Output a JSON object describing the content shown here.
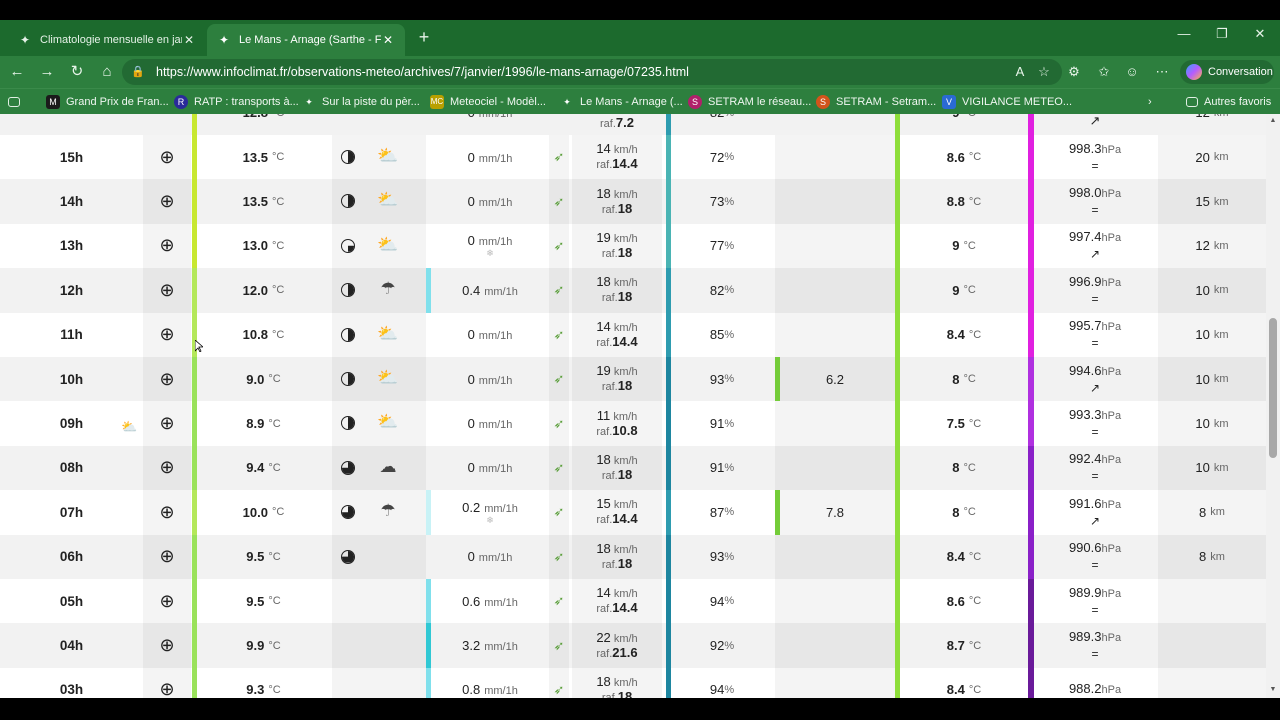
{
  "tabs": [
    {
      "label": "Climatologie mensuelle en janvier",
      "state": "inactive"
    },
    {
      "label": "Le Mans - Arnage (Sarthe - France",
      "state": "active"
    }
  ],
  "address": {
    "url": "https://www.infoclimat.fr/observations-meteo/archives/7/janvier/1996/le-mans-arnage/07235.html"
  },
  "conversation_label": "Conversation",
  "favorites": [
    {
      "label": "Grand Prix de Fran...",
      "icon": "M",
      "color": "#1b1b1b"
    },
    {
      "label": "RATP : transports à...",
      "icon": "R",
      "color": "#2a2a9a"
    },
    {
      "label": "Sur la piste du pèr...",
      "icon": "✦",
      "color": "#333"
    },
    {
      "label": "Meteociel - Modèl...",
      "icon": "MC",
      "color": "#b8a000"
    },
    {
      "label": "Le Mans - Arnage (...",
      "icon": "✦",
      "color": "#333"
    },
    {
      "label": "SETRAM le réseau...",
      "icon": "S",
      "color": "#b0206a"
    },
    {
      "label": "SETRAM - Setram...",
      "icon": "S",
      "color": "#d2541b"
    },
    {
      "label": "VIGILANCE METEO...",
      "icon": "V",
      "color": "#2a6ad2"
    },
    {
      "label": "Autres favoris",
      "icon": "▭",
      "color": "transparent"
    }
  ],
  "rows": [
    {
      "hour": "15h",
      "temp": "13.5",
      "moon": 0.5,
      "wx": "partly-cloudy",
      "prec": "0",
      "snow": "",
      "wind": "14",
      "gust": "14.4",
      "hum": "72",
      "extra": "",
      "dew": "8.6",
      "pres": "998.3",
      "trend": "=",
      "vis": "20"
    },
    {
      "hour": "14h",
      "temp": "13.5",
      "moon": 0.5,
      "wx": "partly-cloudy",
      "prec": "0",
      "snow": "",
      "wind": "18",
      "gust": "18",
      "hum": "73",
      "extra": "",
      "dew": "8.8",
      "pres": "998.0",
      "trend": "=",
      "vis": "15"
    },
    {
      "hour": "13h",
      "temp": "13.0",
      "moon": 0.4,
      "wx": "partly-cloudy",
      "prec": "0",
      "snow": "❄",
      "wind": "19",
      "gust": "18",
      "hum": "77",
      "extra": "",
      "dew": "9",
      "pres": "997.4",
      "trend": "↗",
      "vis": "12"
    },
    {
      "hour": "12h",
      "temp": "12.0",
      "moon": 0.5,
      "wx": "rain",
      "prec": "0.4",
      "snow": "",
      "wind": "18",
      "gust": "18",
      "hum": "82",
      "extra": "",
      "dew": "9",
      "pres": "996.9",
      "trend": "=",
      "vis": "10"
    },
    {
      "hour": "11h",
      "temp": "10.8",
      "moon": 0.5,
      "wx": "partly-cloudy",
      "prec": "0",
      "snow": "",
      "wind": "14",
      "gust": "14.4",
      "hum": "85",
      "extra": "",
      "dew": "8.4",
      "pres": "995.7",
      "trend": "=",
      "vis": "10"
    },
    {
      "hour": "10h",
      "temp": "9.0",
      "moon": 0.5,
      "wx": "partly-cloudy",
      "prec": "0",
      "snow": "",
      "wind": "19",
      "gust": "18",
      "hum": "93",
      "extra": "6.2",
      "dew": "8",
      "pres": "994.6",
      "trend": "↗",
      "vis": "10"
    },
    {
      "hour": "09h",
      "temp": "8.9",
      "moon": 0.5,
      "wx": "partly-cloudy",
      "prec": "0",
      "snow": "",
      "wind": "11",
      "gust": "10.8",
      "hum": "91",
      "extra": "",
      "dew": "7.5",
      "pres": "993.3",
      "trend": "=",
      "vis": "10"
    },
    {
      "hour": "08h",
      "temp": "9.4",
      "moon": 0.75,
      "wx": "cloud",
      "prec": "0",
      "snow": "",
      "wind": "18",
      "gust": "18",
      "hum": "91",
      "extra": "",
      "dew": "8",
      "pres": "992.4",
      "trend": "=",
      "vis": "10"
    },
    {
      "hour": "07h",
      "temp": "10.0",
      "moon": 0.75,
      "wx": "rain-snow",
      "prec": "0.2",
      "snow": "❄",
      "wind": "15",
      "gust": "14.4",
      "hum": "87",
      "extra": "7.8",
      "dew": "8",
      "pres": "991.6",
      "trend": "↗",
      "vis": "8"
    },
    {
      "hour": "06h",
      "temp": "9.5",
      "moon": 0.75,
      "wx": "",
      "prec": "0",
      "snow": "",
      "wind": "18",
      "gust": "18",
      "hum": "93",
      "extra": "",
      "dew": "8.4",
      "pres": "990.6",
      "trend": "=",
      "vis": "8"
    },
    {
      "hour": "05h",
      "temp": "9.5",
      "moon": 0,
      "wx": "",
      "prec": "0.6",
      "snow": "",
      "wind": "14",
      "gust": "14.4",
      "hum": "94",
      "extra": "",
      "dew": "8.6",
      "pres": "989.9",
      "trend": "=",
      "vis": ""
    },
    {
      "hour": "04h",
      "temp": "9.9",
      "moon": 0,
      "wx": "",
      "prec": "3.2",
      "snow": "",
      "wind": "22",
      "gust": "21.6",
      "hum": "92",
      "extra": "",
      "dew": "8.7",
      "pres": "989.3",
      "trend": "=",
      "vis": ""
    },
    {
      "hour": "03h",
      "temp": "9.3",
      "moon": 0,
      "wx": "",
      "prec": "0.8",
      "snow": "",
      "wind": "18",
      "gust": "18",
      "hum": "94",
      "extra": "",
      "dew": "8.4",
      "pres": "988.2",
      "trend": "",
      "vis": ""
    }
  ],
  "partial_top": {
    "temp": "12.8",
    "prec": "0",
    "gust": "7.2",
    "hum": "82",
    "dew": "9",
    "vis": "12"
  },
  "units": {
    "temp": "°C",
    "prec": "mm/1h",
    "wind": "km/h",
    "gust_prefix": "raf.",
    "hum": "%",
    "pres": "hPa",
    "vis": "km"
  },
  "colors": {
    "browser_green": "#2d7f3e",
    "tab_green": "#1c6a2d"
  }
}
